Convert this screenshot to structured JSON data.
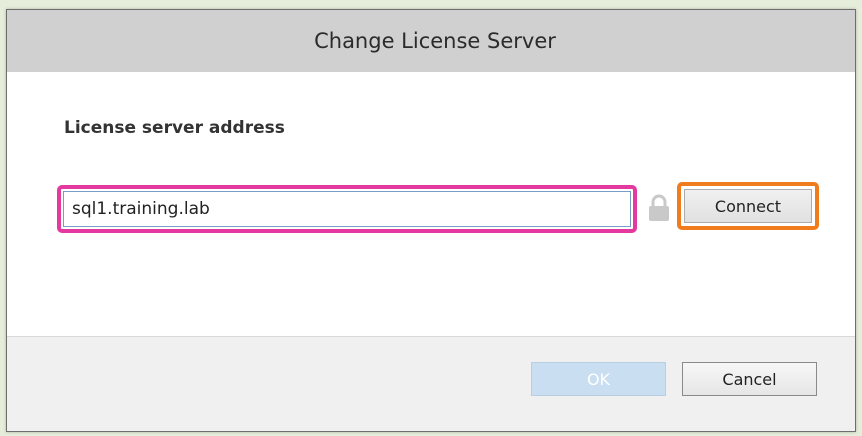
{
  "dialog": {
    "title": "Change License Server",
    "field_label": "License server address",
    "address_value": "sql1.training.lab",
    "connect_label": "Connect",
    "ok_label": "OK",
    "cancel_label": "Cancel",
    "icons": {
      "lock": "lock-icon"
    }
  }
}
